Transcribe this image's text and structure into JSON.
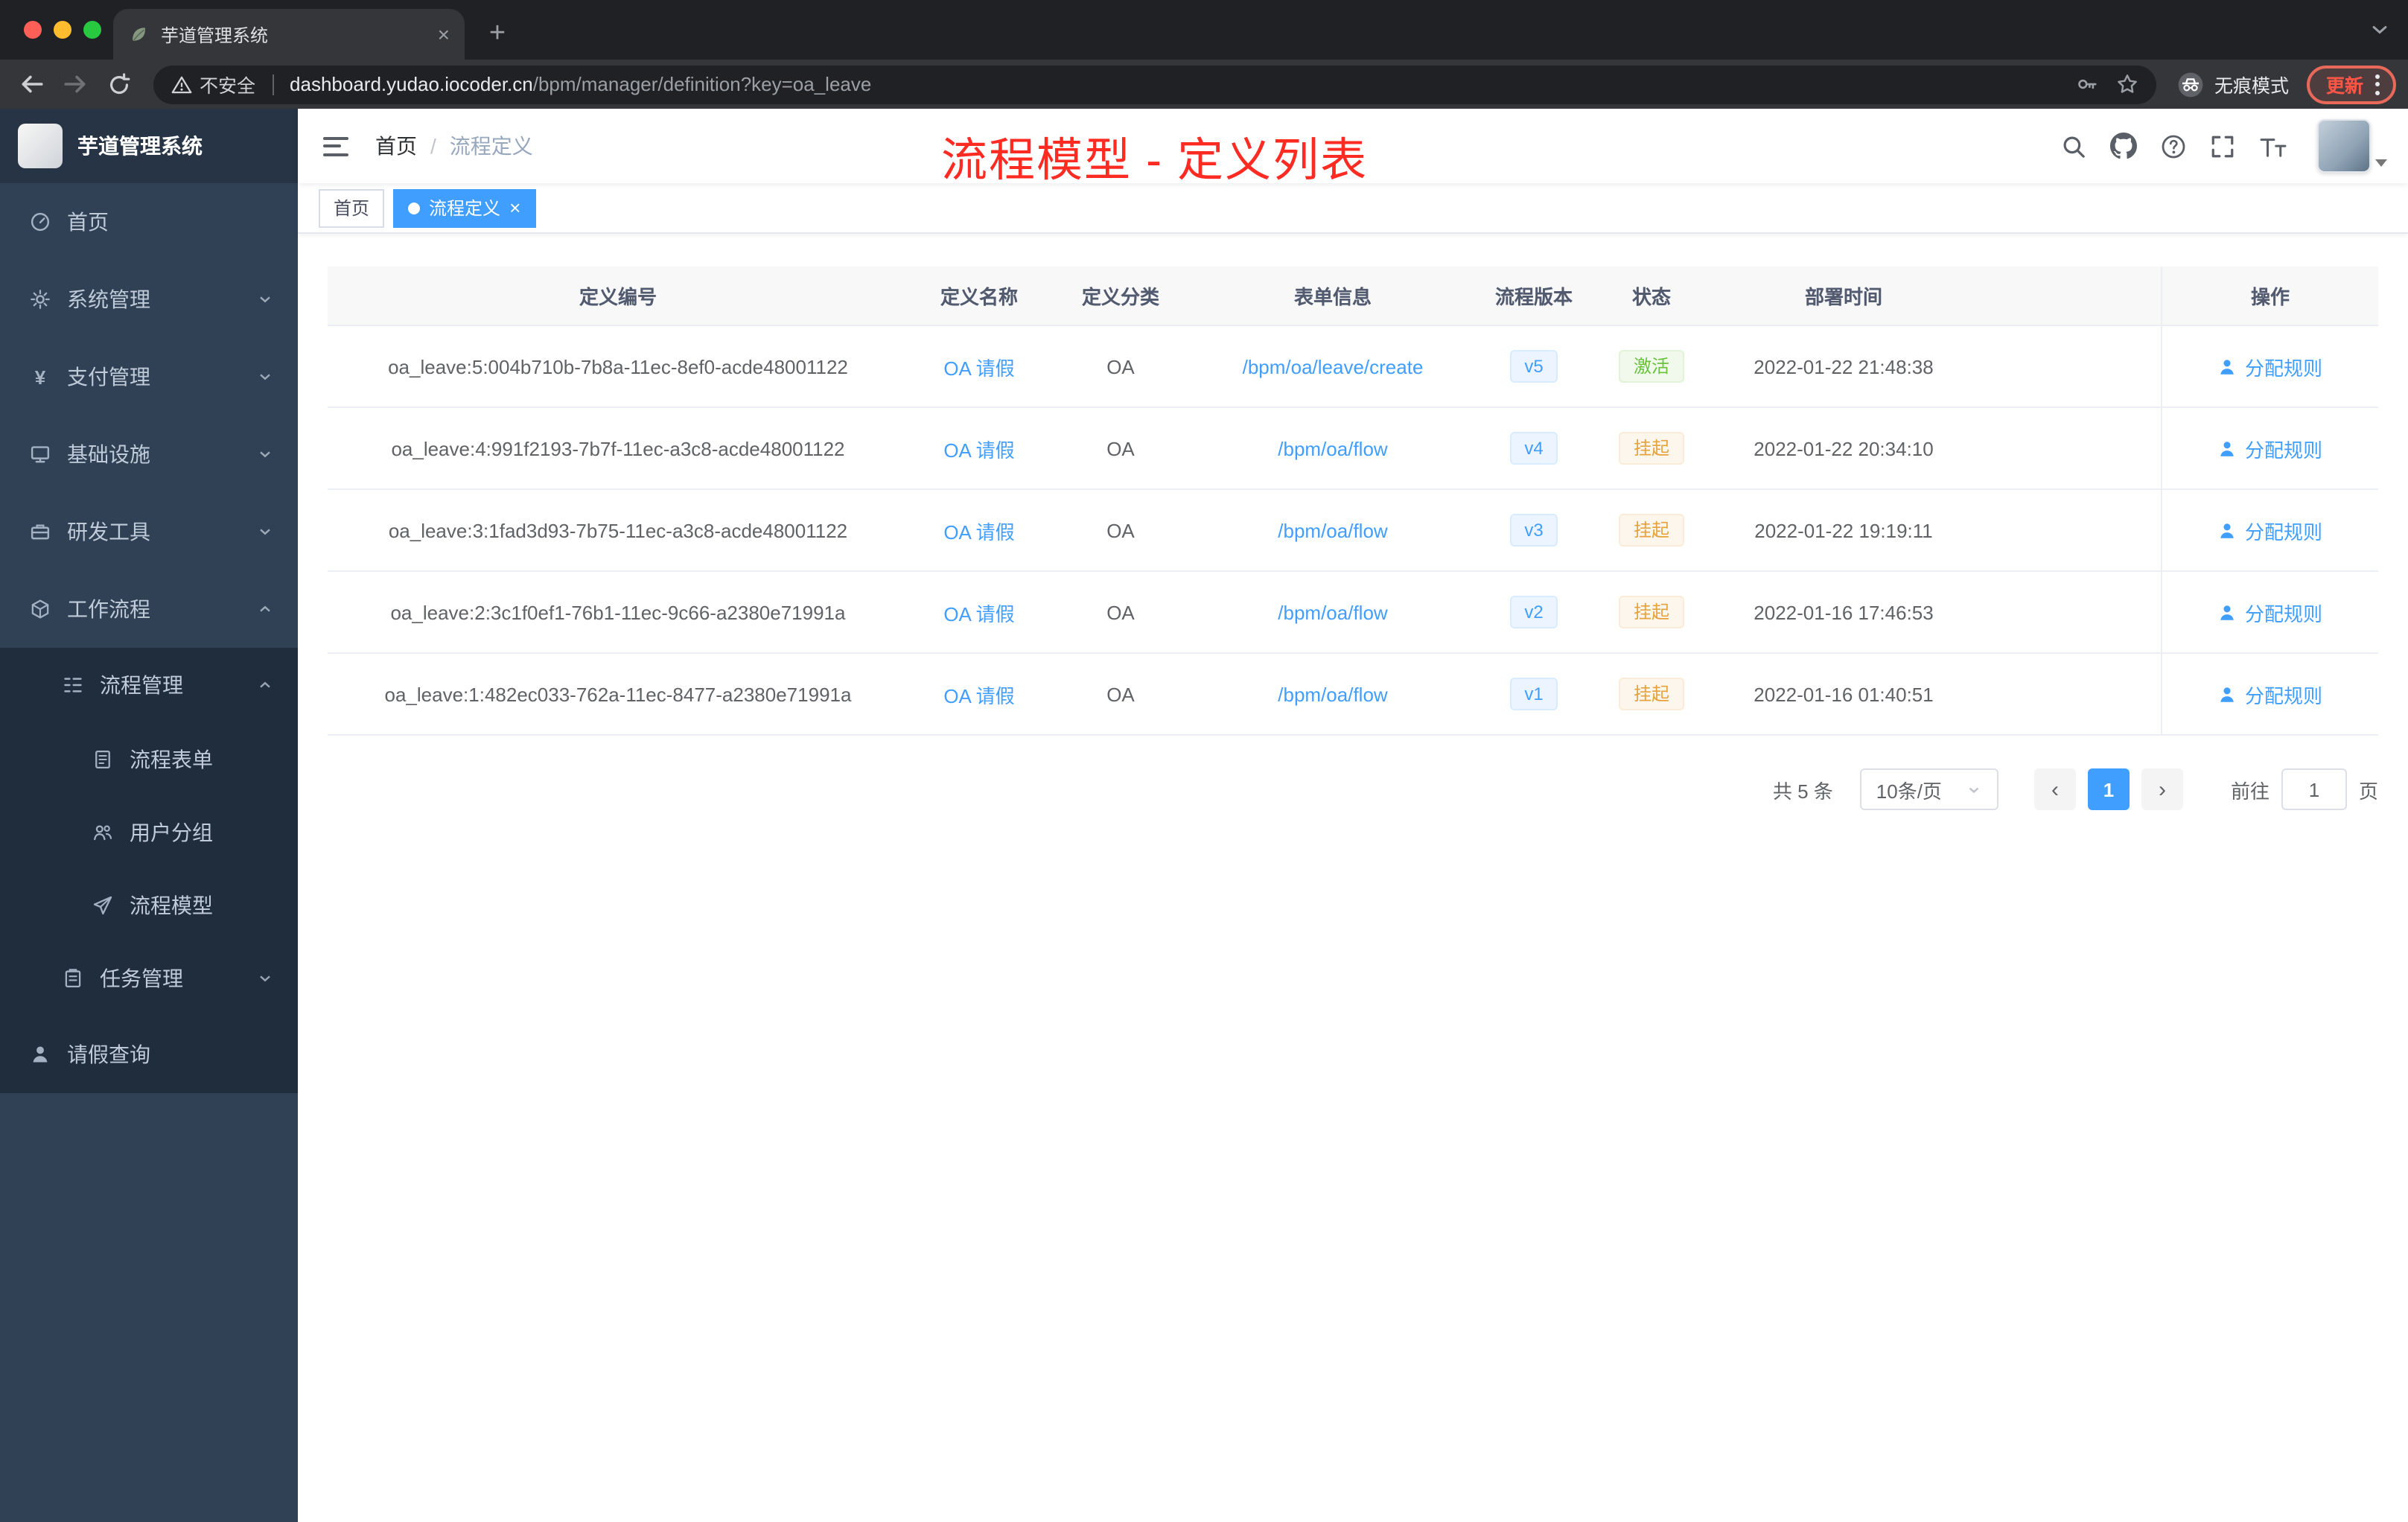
{
  "glyphs": {
    "close": "×",
    "plus": "+",
    "prev": "‹",
    "next": "›",
    "slash": "/",
    "yen": "¥"
  },
  "browser": {
    "tab_title": "芋道管理系统",
    "security_label": "不安全",
    "url_domain": "dashboard.yudao.iocoder.cn",
    "url_path": "/bpm/manager/definition?key=oa_leave",
    "incognito_label": "无痕模式",
    "update_label": "更新"
  },
  "sidebar": {
    "logo_title": "芋道管理系统",
    "items": [
      {
        "label": "首页"
      },
      {
        "label": "系统管理"
      },
      {
        "label": "支付管理"
      },
      {
        "label": "基础设施"
      },
      {
        "label": "研发工具"
      },
      {
        "label": "工作流程"
      },
      {
        "label": "流程管理"
      },
      {
        "label": "流程表单"
      },
      {
        "label": "用户分组"
      },
      {
        "label": "流程模型"
      },
      {
        "label": "任务管理"
      },
      {
        "label": "请假查询"
      }
    ]
  },
  "header": {
    "breadcrumb": [
      "首页",
      "流程定义"
    ],
    "annotation": "流程模型 - 定义列表"
  },
  "tags": [
    {
      "label": "首页"
    },
    {
      "label": "流程定义"
    }
  ],
  "table": {
    "columns": [
      "定义编号",
      "定义名称",
      "定义分类",
      "表单信息",
      "流程版本",
      "状态",
      "部署时间",
      "操作"
    ],
    "rows": [
      {
        "id": "oa_leave:5:004b710b-7b8a-11ec-8ef0-acde48001122",
        "name": "OA 请假",
        "category": "OA",
        "form": "/bpm/oa/leave/create",
        "version": "v5",
        "status": "激活",
        "status_class": "tag-status st-success",
        "time": "2022-01-22 21:48:38",
        "action": "分配规则"
      },
      {
        "id": "oa_leave:4:991f2193-7b7f-11ec-a3c8-acde48001122",
        "name": "OA 请假",
        "category": "OA",
        "form": "/bpm/oa/flow",
        "version": "v4",
        "status": "挂起",
        "status_class": "tag-status st-warning",
        "time": "2022-01-22 20:34:10",
        "action": "分配规则"
      },
      {
        "id": "oa_leave:3:1fad3d93-7b75-11ec-a3c8-acde48001122",
        "name": "OA 请假",
        "category": "OA",
        "form": "/bpm/oa/flow",
        "version": "v3",
        "status": "挂起",
        "status_class": "tag-status st-warning",
        "time": "2022-01-22 19:19:11",
        "action": "分配规则"
      },
      {
        "id": "oa_leave:2:3c1f0ef1-76b1-11ec-9c66-a2380e71991a",
        "name": "OA 请假",
        "category": "OA",
        "form": "/bpm/oa/flow",
        "version": "v2",
        "status": "挂起",
        "status_class": "tag-status st-warning",
        "time": "2022-01-16 17:46:53",
        "action": "分配规则"
      },
      {
        "id": "oa_leave:1:482ec033-762a-11ec-8477-a2380e71991a",
        "name": "OA 请假",
        "category": "OA",
        "form": "/bpm/oa/flow",
        "version": "v1",
        "status": "挂起",
        "status_class": "tag-status st-warning",
        "time": "2022-01-16 01:40:51",
        "action": "分配规则"
      }
    ]
  },
  "pagination": {
    "total": "共 5 条",
    "size": "10条/页",
    "page": "1",
    "goto_label": "前往",
    "page_value": "1",
    "unit": "页"
  }
}
